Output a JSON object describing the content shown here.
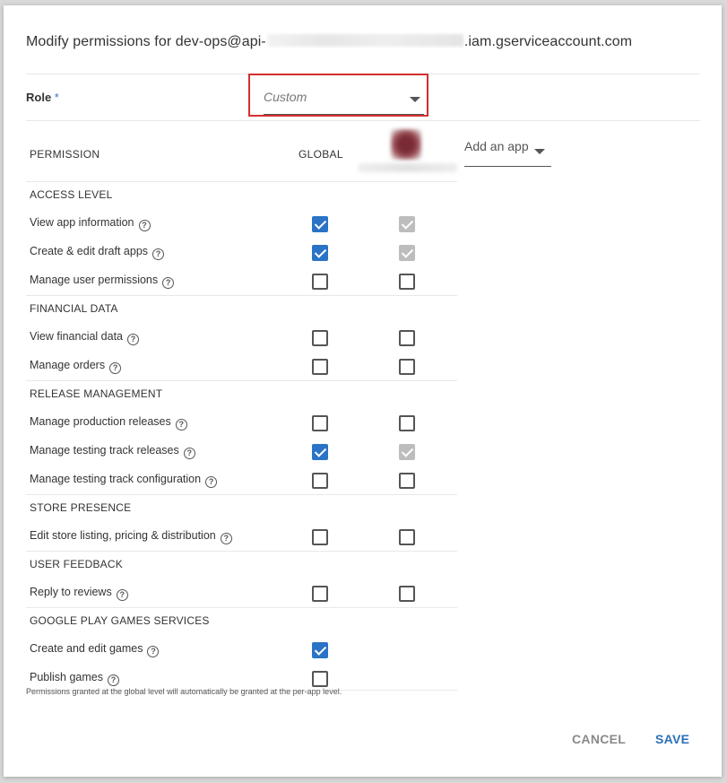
{
  "dialog": {
    "title_prefix": "Modify permissions for dev-ops@api-",
    "title_suffix": ".iam.gserviceaccount.com"
  },
  "role": {
    "label": "Role",
    "required_mark": "*",
    "value": "Custom"
  },
  "table": {
    "header_permission": "PERMISSION",
    "header_global": "GLOBAL",
    "add_app_label": "Add an app",
    "sections": [
      {
        "title": "ACCESS LEVEL",
        "rows": [
          {
            "label": "View app information",
            "global": true,
            "app": "checked-disabled"
          },
          {
            "label": "Create & edit draft apps",
            "global": true,
            "app": "checked-disabled"
          },
          {
            "label": "Manage user permissions",
            "global": false,
            "app": "unchecked"
          }
        ]
      },
      {
        "title": "FINANCIAL DATA",
        "rows": [
          {
            "label": "View financial data",
            "global": false,
            "app": "unchecked"
          },
          {
            "label": "Manage orders",
            "global": false,
            "app": "unchecked"
          }
        ]
      },
      {
        "title": "RELEASE MANAGEMENT",
        "rows": [
          {
            "label": "Manage production releases",
            "global": false,
            "app": "unchecked"
          },
          {
            "label": "Manage testing track releases",
            "global": true,
            "app": "checked-disabled"
          },
          {
            "label": "Manage testing track configuration",
            "global": false,
            "app": "unchecked"
          }
        ]
      },
      {
        "title": "STORE PRESENCE",
        "rows": [
          {
            "label": "Edit store listing, pricing & distribution",
            "global": false,
            "app": "unchecked"
          }
        ]
      },
      {
        "title": "USER FEEDBACK",
        "rows": [
          {
            "label": "Reply to reviews",
            "global": false,
            "app": "unchecked"
          }
        ]
      },
      {
        "title": "GOOGLE PLAY GAMES SERVICES",
        "rows": [
          {
            "label": "Create and edit games",
            "global": true,
            "app": "none"
          },
          {
            "label": "Publish games",
            "global": false,
            "app": "none"
          }
        ]
      }
    ]
  },
  "footnote": "Permissions granted at the global level will automatically be granted at the per-app level.",
  "actions": {
    "cancel": "CANCEL",
    "save": "SAVE"
  },
  "colors": {
    "accent": "#2a73c6",
    "highlight_border": "#d32f2f",
    "disabled_check": "#bdbdbd"
  },
  "icons": {
    "help": "help-circle-icon",
    "dropdown": "caret-down-icon",
    "checkbox": "checkbox-icon"
  }
}
